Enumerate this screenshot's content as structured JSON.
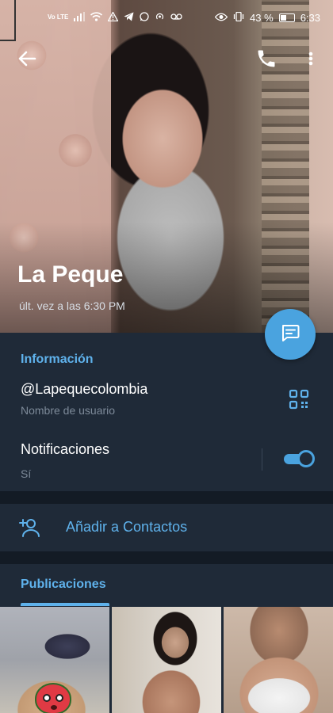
{
  "status_bar": {
    "network_label": "Vo LTE",
    "battery_percent": "43 %",
    "time": "6:33"
  },
  "profile": {
    "name": "La Peque",
    "last_seen": "últ. vez a las 6:30 PM"
  },
  "info": {
    "section_title": "Información",
    "username": "@Lapequecolombia",
    "username_label": "Nombre de usuario",
    "notifications_title": "Notificaciones",
    "notifications_value": "Sí",
    "notifications_enabled": true
  },
  "actions": {
    "add_contact_label": "Añadir a Contactos"
  },
  "posts": {
    "section_title": "Publicaciones"
  },
  "colors": {
    "accent": "#4aa3df",
    "section_title": "#5fb2ec",
    "background": "#1f2a38",
    "divider": "#131b25"
  },
  "icons": {
    "back": "arrow-left-icon",
    "call": "phone-icon",
    "more": "more-vertical-icon",
    "message": "message-icon",
    "qr": "qr-code-icon",
    "add_contact": "add-person-icon"
  }
}
